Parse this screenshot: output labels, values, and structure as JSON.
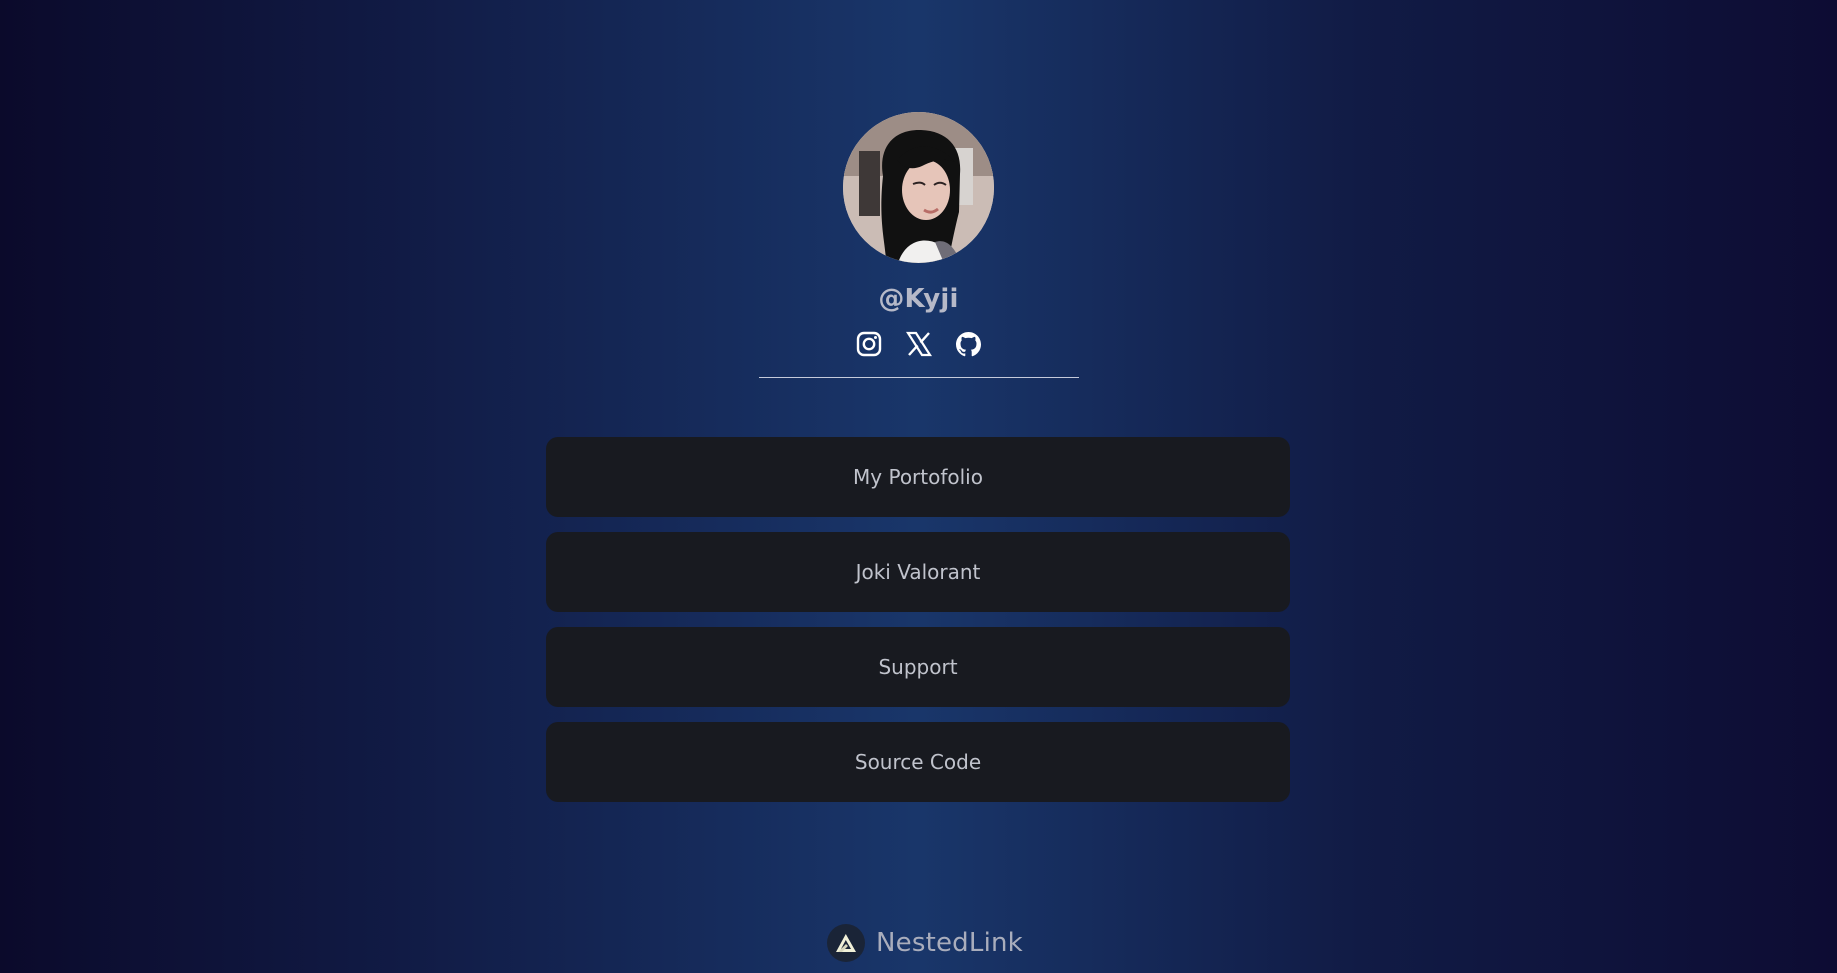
{
  "profile": {
    "username": "@Kyji",
    "avatar_icon": "profile-photo"
  },
  "socials": [
    {
      "icon": "instagram-icon"
    },
    {
      "icon": "x-twitter-icon"
    },
    {
      "icon": "github-icon"
    }
  ],
  "links": [
    {
      "label": "My Portofolio"
    },
    {
      "label": "Joki Valorant"
    },
    {
      "label": "Support"
    },
    {
      "label": "Source Code"
    }
  ],
  "footer": {
    "brand": "NestedLink",
    "logo_icon": "nestedlink-logo-icon"
  },
  "colors": {
    "background_center": "#19366a",
    "background_edge": "#0b0a2b",
    "button_background": "#181a20",
    "text": "#c0c3cc"
  }
}
